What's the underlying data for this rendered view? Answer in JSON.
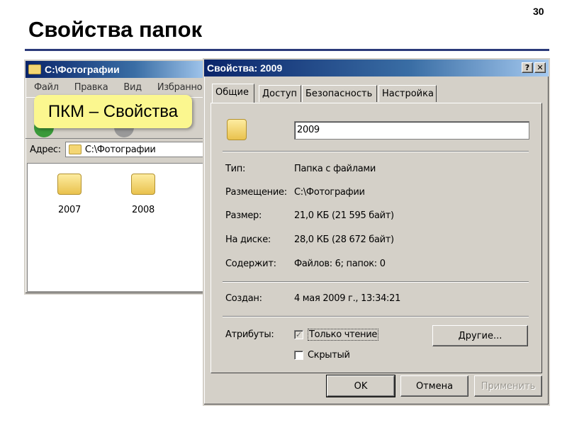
{
  "slide": {
    "title": "Свойства папок",
    "page_number": "30"
  },
  "explorer": {
    "title": "C:\\Фотографии",
    "menu": [
      "Файл",
      "Правка",
      "Вид",
      "Избранное"
    ],
    "address_label": "Адрес:",
    "address_value": "C:\\Фотографии",
    "folders": [
      "2007",
      "2008"
    ]
  },
  "callout": {
    "text": "ПКМ – Свойства"
  },
  "dialog": {
    "title": "Свойства: 2009",
    "help": "?",
    "close": "✕",
    "tabs": [
      "Общие",
      "Доступ",
      "Безопасность",
      "Настройка"
    ],
    "name_value": "2009",
    "props": [
      {
        "label": "Тип:",
        "value": "Папка с файлами"
      },
      {
        "label": "Размещение:",
        "value": "C:\\Фотографии"
      },
      {
        "label": "Размер:",
        "value": "21,0 КБ (21 595 байт)"
      },
      {
        "label": "На диске:",
        "value": "28,0 КБ (28 672 байт)"
      },
      {
        "label": "Содержит:",
        "value": "Файлов: 6; папок: 0"
      }
    ],
    "created": {
      "label": "Создан:",
      "value": "4 мая 2009 г., 13:34:21"
    },
    "attributes_label": "Атрибуты:",
    "readonly": {
      "label": "Только чтение",
      "checked": true
    },
    "hidden": {
      "label": "Скрытый",
      "checked": false
    },
    "other_button": "Другие...",
    "ok": "OK",
    "cancel": "Отмена",
    "apply": "Применить"
  }
}
